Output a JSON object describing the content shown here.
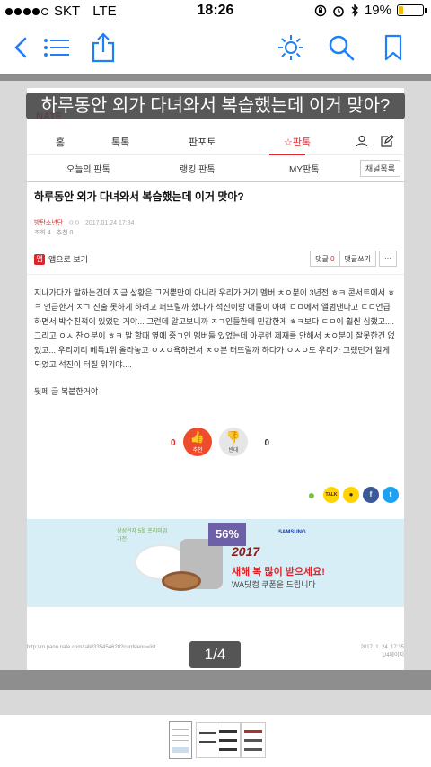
{
  "status_bar": {
    "carrier": "SKT",
    "network": "LTE",
    "time": "18:26",
    "battery": "19%",
    "battery_level": 0.19
  },
  "toolbar": {
    "back_icon": "chevron-left-icon",
    "list_icon": "list-icon",
    "share_icon": "share-icon",
    "brightness_icon": "sun-icon",
    "search_icon": "search-icon",
    "bookmark_icon": "bookmark-icon"
  },
  "page": {
    "overlay_title": "하루동안 외가 다녀와서 복습했는데 이거 맞아?",
    "brand": "NATE",
    "main_nav": [
      "홈",
      "톡톡",
      "판포토",
      "판톡"
    ],
    "sub_nav": [
      "오늘의 판톡",
      "랭킹 판톡",
      "MY판톡"
    ],
    "channel_button": "채널목록",
    "post_title": "하루동안 외가 다녀와서 복습했는데 이거 맞아?",
    "author": "방탄소년단",
    "author_suffix": "ㅇㅇ",
    "datetime": "2017.01.24 17:34",
    "views": "조회 4",
    "recommend": "추천 0",
    "app_view": "앱으로 보기",
    "comment_label": "댓글",
    "comment_count": "0",
    "write_comment": "댓글쓰기",
    "more": "···",
    "paragraph1": "지나가다가 말하는건데 지금 상황은 그거뿐만이 아니라 우리가 거기 멤버 ㅊㅇ분이 3년전 ㅎㅋ 콘서트에서 ㅎㅋ 언급한거 ㅈㄱ 진출 못하게 하려고 퍼뜨릴까 했다가 석진이랑 애들이 아예 ㄷㅁ에서 앨범낸다고 ㄷㅁ언급하면서 박수친적이 있었던 거야... 그런데 알고보니까 ㅈㄱ인들한테 민감한게 ㅎㅋ보다 ㄷㅁ이 훨씬 심했고.... 그리고 ㅇㅅ 찬ㅇ분이 ㅎㅋ 말 할때 옆에 중ㄱ인 멤버들 있었는데 아무런 제재를 안해서 ㅊㅇ분이 잘못한건 없었고... 우리끼리 베톡1위 올라놓고 ㅇㅅㅇ욕하면서 ㅊㅇ분 터뜨릴까 하다가 ㅇㅅㅇ도 우리가 그랬던거 알게되었고 석진이 터질 위기야....",
    "paragraph2": "뒷페 글 복붙한거야",
    "vote_up_count": "0",
    "vote_up_label": "추천",
    "vote_down_count": "0",
    "vote_down_label": "반대",
    "share_buttons": [
      "kakaostory",
      "kakaotalk",
      "kakao",
      "facebook",
      "twitter"
    ],
    "share_labels": [
      "",
      "TALK",
      "",
      "f",
      ""
    ],
    "ad": {
      "brand": "삼성전자 5월 프리미엄 가전",
      "discount": "56%",
      "maker": "SAMSUNG",
      "year": "2017",
      "headline": "새해 복 많이 받으세요!",
      "subline": "WA닷컴 쿠폰을 드립니다"
    },
    "url": "http://m.pann.nate.com/talk/335454628?currMenu=list",
    "footer_date": "2017. 1. 24. 17:35",
    "footer_pages": "1/4페이지"
  },
  "pager": "1/4",
  "colors": {
    "accent": "#e0242b",
    "toolbar_icon": "#1e7ff6",
    "vote_up": "#ee4c2c",
    "facebook": "#3b5998",
    "twitter": "#1da1f2",
    "kakao": "#ffd400"
  }
}
